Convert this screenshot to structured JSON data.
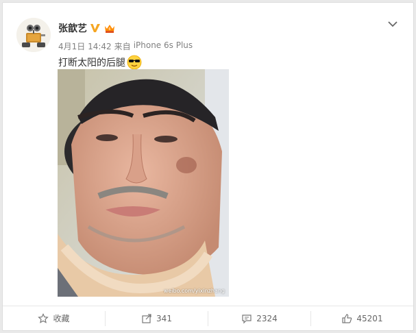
{
  "post": {
    "author": "张歆艺",
    "time": "4月1日 14:42",
    "source_prefix": "来自",
    "source": "iPhone 6s Plus",
    "text": "打断太阳的后腿",
    "watermark": "weibo.com/yixinzhang"
  },
  "icons": {
    "avatar": "robot-avatar",
    "verified": "verified-v-icon",
    "vip": "vip-crown-icon",
    "emoji": "sunglasses-emoji",
    "menu": "chevron-down-icon",
    "favorite": "star-icon",
    "repost": "share-arrow-icon",
    "comment": "comment-icon",
    "like": "thumbs-up-icon"
  },
  "actions": {
    "favorite_label": "收藏",
    "repost_count": "341",
    "comment_count": "2324",
    "like_count": "45201"
  },
  "colors": {
    "verified": "#f5a623",
    "vip": "#ff8c00",
    "text_secondary": "#808080",
    "background": "#e9e9e9"
  }
}
